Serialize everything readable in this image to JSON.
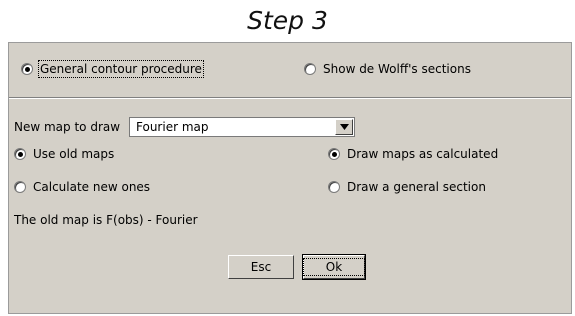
{
  "page_title": "Step 3",
  "dialog": {
    "mode_options": [
      {
        "label": "General contour procedure",
        "checked": true
      },
      {
        "label": "Show de Wolff's sections",
        "checked": false
      }
    ],
    "map_select": {
      "label": "New map to draw",
      "value": "Fourier map"
    },
    "map_source_options": [
      {
        "label": "Use old maps",
        "checked": true
      },
      {
        "label": "Calculate new ones",
        "checked": false
      }
    ],
    "draw_options": [
      {
        "label": "Draw maps as calculated",
        "checked": true
      },
      {
        "label": "Draw a general section",
        "checked": false
      }
    ],
    "status_text": "The old map is F(obs) - Fourier",
    "buttons": {
      "esc_label": "Esc",
      "ok_label": "Ok"
    },
    "icons": {
      "dropdown": "chevron-down-icon"
    }
  }
}
